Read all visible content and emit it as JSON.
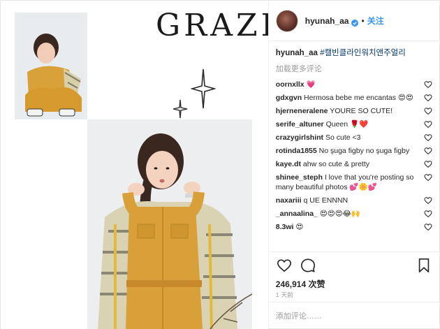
{
  "media": {
    "magazine_logo": "GRAZIA"
  },
  "header": {
    "username": "hyunah_aa",
    "separator": "•",
    "follow_label": "关注"
  },
  "caption": {
    "username": "hyunah_aa",
    "text": "#캘빈클라인워치앤주얼리"
  },
  "load_more": "加载更多评论",
  "comments": [
    {
      "user": "oornxllx",
      "text": "💗"
    },
    {
      "user": "gdxgvn",
      "text": "Hermosa bebe me encantas 😍😍"
    },
    {
      "user": "hjerneneralene",
      "text": "YOURE SO CUTE!"
    },
    {
      "user": "serife_altuner",
      "text": "Queen 🌹❤️"
    },
    {
      "user": "crazygirlshint",
      "text": "So cute <3"
    },
    {
      "user": "rotinda1855",
      "text": "No şuga figby no şuga figby"
    },
    {
      "user": "kaye.dt",
      "text": "ahw so cute & pretty"
    },
    {
      "user": "shinee_steph",
      "text": "I love that you're posting so many beautiful photos 💕🌼💕"
    },
    {
      "user": "naxariii",
      "text": "q UE ENNNN"
    },
    {
      "user": "_annaalina_",
      "text": "😍😍😍😂🙌"
    },
    {
      "user": "8.3wi",
      "text": "😍"
    }
  ],
  "likes": "246,914 次赞",
  "time": "1 天前",
  "add_comment_placeholder": "添加评论……",
  "colors": {
    "link_blue": "#3897f0",
    "text": "#262626",
    "muted": "#999999",
    "verified_blue": "#3897f0"
  }
}
